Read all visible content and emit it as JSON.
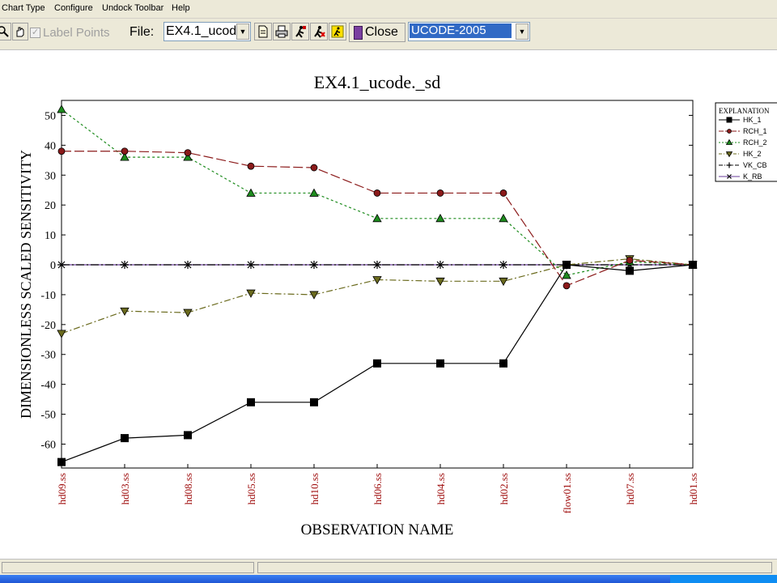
{
  "menubar": {
    "items": [
      "Chart Type",
      "Configure",
      "Undock Toolbar",
      "Help"
    ]
  },
  "toolbar": {
    "label_points": "Label Points",
    "file_label": "File:",
    "file_value": "EX4.1_ucod",
    "close_label": "Close",
    "program_value": "UCODE-2005"
  },
  "chart_data": {
    "type": "line",
    "title": "EX4.1_ucode._sd",
    "xlabel": "OBSERVATION NAME",
    "ylabel": "DIMENSIONLESS SCALED SENSITIVITY",
    "categories": [
      "hd09.ss",
      "hd03.ss",
      "hd08.ss",
      "hd05.ss",
      "hd10.ss",
      "hd06.ss",
      "hd04.ss",
      "hd02.ss",
      "flow01.ss",
      "hd07.ss",
      "hd01.ss"
    ],
    "ylim": [
      -68,
      55
    ],
    "yticks": [
      50,
      40,
      30,
      20,
      10,
      0,
      -10,
      -20,
      -30,
      -40,
      -50,
      -60
    ],
    "legend_title": "EXPLANATION",
    "legend_position": "right",
    "series": [
      {
        "name": "HK_1",
        "color": "#000000",
        "dash": "",
        "marker": "square",
        "values": [
          -66,
          -58,
          -57,
          -46,
          -46,
          -33,
          -33,
          -33,
          0,
          -2,
          0
        ]
      },
      {
        "name": "RCH_1",
        "color": "#8b1a1a",
        "dash": "12,4",
        "marker": "circle",
        "values": [
          38,
          38,
          37.5,
          33,
          32.5,
          24,
          24,
          24,
          -7,
          1.5,
          0
        ]
      },
      {
        "name": "RCH_2",
        "color": "#1e8c1e",
        "dash": "3,3",
        "marker": "triangle-up",
        "values": [
          52,
          36,
          36,
          24,
          24,
          15.5,
          15.5,
          15.5,
          -3.5,
          1,
          0
        ]
      },
      {
        "name": "HK_2",
        "color": "#6b6b1e",
        "dash": "8,3,2,3",
        "marker": "triangle-down",
        "values": [
          -23,
          -15.5,
          -16,
          -9.5,
          -10,
          -5,
          -5.5,
          -5.5,
          0,
          2,
          0
        ]
      },
      {
        "name": "VK_CB",
        "color": "#000000",
        "dash": "10,3,2,3",
        "marker": "plus",
        "values": [
          0,
          0,
          0,
          0,
          0,
          0,
          0,
          0,
          0,
          0,
          0
        ]
      },
      {
        "name": "K_RB",
        "color": "#6a3d9a",
        "dash": "",
        "marker": "x",
        "values": [
          0,
          0,
          0,
          0,
          0,
          0,
          0,
          0,
          0,
          0,
          0
        ]
      }
    ]
  }
}
